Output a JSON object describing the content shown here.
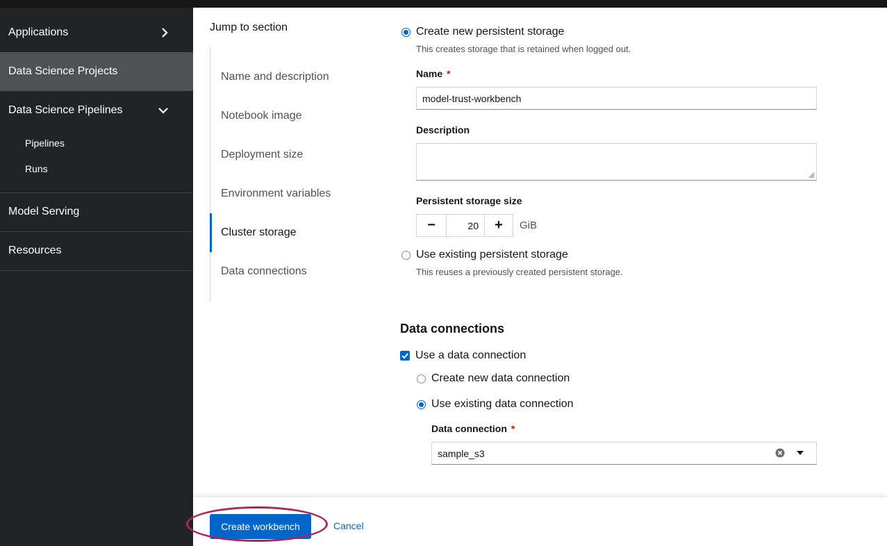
{
  "sidebar": {
    "items": [
      {
        "label": "Applications",
        "icon": "chevron-right-icon"
      },
      {
        "label": "Data Science Projects",
        "active": true
      },
      {
        "label": "Data Science Pipelines",
        "icon": "chevron-down-icon",
        "children": [
          {
            "label": "Pipelines"
          },
          {
            "label": "Runs"
          }
        ]
      },
      {
        "label": "Model Serving"
      },
      {
        "label": "Resources"
      }
    ]
  },
  "jump": {
    "title": "Jump to section",
    "links": [
      "Name and description",
      "Notebook image",
      "Deployment size",
      "Environment variables",
      "Cluster storage",
      "Data connections"
    ],
    "active": "Cluster storage"
  },
  "storage": {
    "create_new_label": "Create new persistent storage",
    "create_new_help": "This creates storage that is retained when logged out.",
    "name_label": "Name",
    "required_mark": "*",
    "name_value": "model-trust-workbench",
    "description_label": "Description",
    "description_value": "",
    "size_label": "Persistent storage size",
    "minus_symbol": "−",
    "plus_symbol": "+",
    "size_value": "20",
    "size_unit": "GiB",
    "use_existing_label": "Use existing persistent storage",
    "use_existing_help": "This reuses a previously created persistent storage."
  },
  "data_connections": {
    "title": "Data connections",
    "use_label": "Use a data connection",
    "use_checked": true,
    "create_new_label": "Create new data connection",
    "use_existing_label": "Use existing data connection",
    "connection_label": "Data connection",
    "connection_value": "sample_s3"
  },
  "footer": {
    "create_label": "Create workbench",
    "cancel_label": "Cancel"
  },
  "colors": {
    "primary": "#0066cc",
    "sidebar_bg": "#212427",
    "sidebar_active": "#4f5255",
    "highlight": "#a8285a",
    "required": "#c9190b"
  }
}
